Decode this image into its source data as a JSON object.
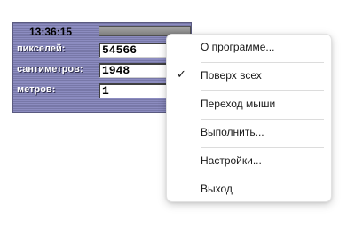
{
  "widget": {
    "clock": "13:36:15",
    "rows": [
      {
        "label": "пикселей:",
        "value": "54566"
      },
      {
        "label": "сантиметров:",
        "value": "1948"
      },
      {
        "label": "метров:",
        "value": "1"
      }
    ]
  },
  "context_menu": {
    "items": [
      {
        "label": "О программе...",
        "checked": false
      },
      {
        "label": "Поверх всех",
        "checked": true,
        "check_glyph": "✓"
      },
      {
        "label": "Переход мыши",
        "checked": false
      },
      {
        "label": "Выполнить...",
        "checked": false
      },
      {
        "label": "Настройки...",
        "checked": false
      },
      {
        "label": "Выход",
        "checked": false
      }
    ]
  },
  "colors": {
    "widget_background": "#8a8ab8",
    "menu_background": "#ffffff"
  }
}
